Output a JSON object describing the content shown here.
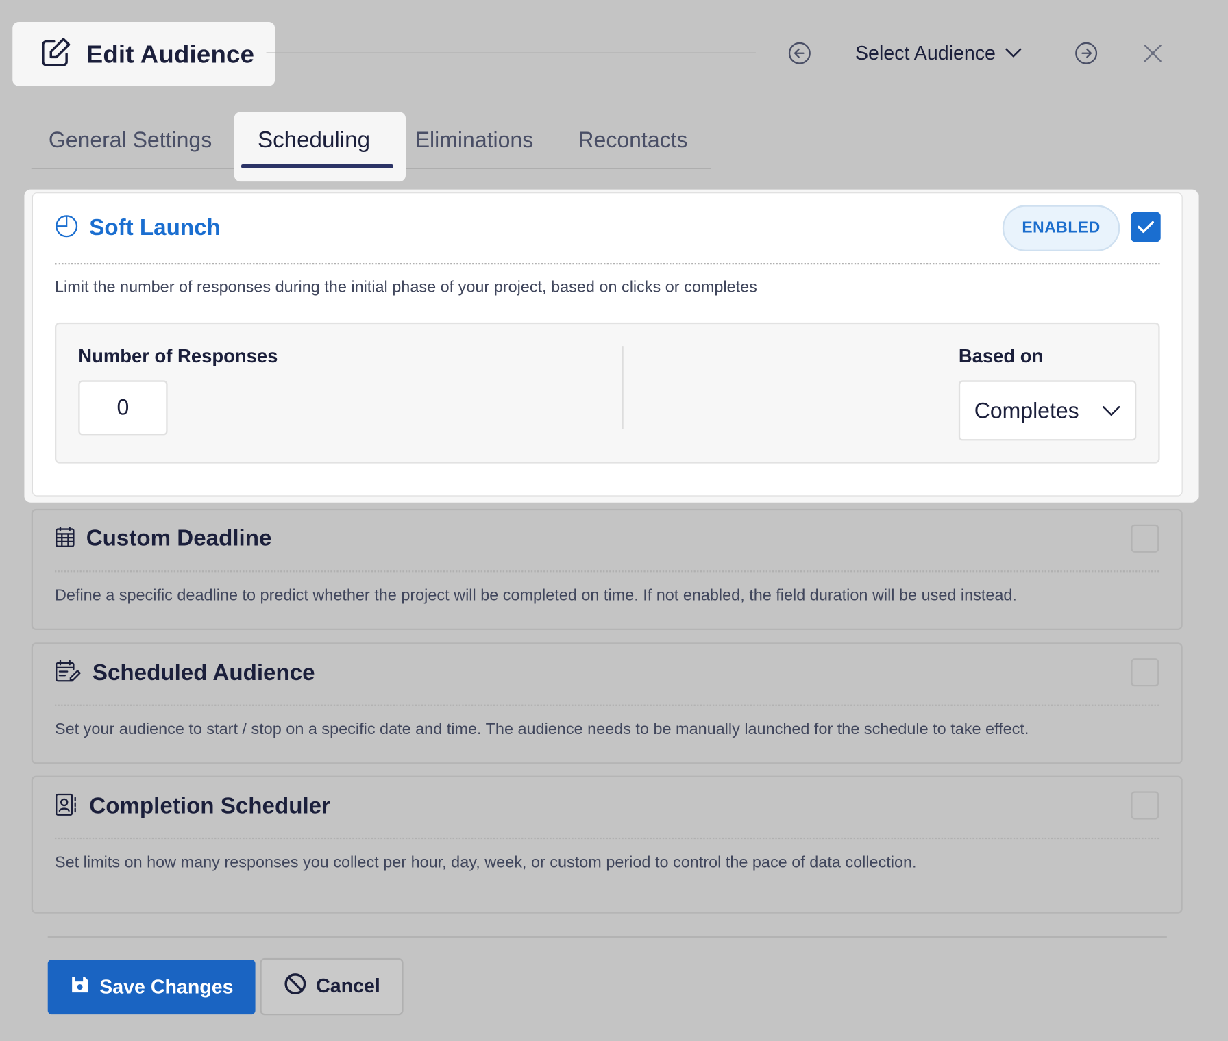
{
  "header": {
    "title": "Edit Audience",
    "select_audience_label": "Select Audience"
  },
  "tabs": [
    {
      "label": "General Settings",
      "active": false
    },
    {
      "label": "Scheduling",
      "active": true
    },
    {
      "label": "Eliminations",
      "active": false
    },
    {
      "label": "Recontacts",
      "active": false
    }
  ],
  "soft_launch": {
    "title": "Soft Launch",
    "status_badge": "ENABLED",
    "checked": true,
    "description": "Limit the number of responses during the initial phase of your project, based on clicks or completes",
    "responses_label": "Number of Responses",
    "responses_value": "0",
    "based_on_label": "Based on",
    "based_on_value": "Completes"
  },
  "sections": [
    {
      "title": "Custom Deadline",
      "icon": "calendar-icon",
      "checked": false,
      "description": "Define a specific deadline to predict whether the project will be completed on time. If not enabled, the field duration will be used instead."
    },
    {
      "title": "Scheduled Audience",
      "icon": "calendar-edit-icon",
      "checked": false,
      "description": "Set your audience to start / stop on a specific date and time. The audience needs to be manually launched for the schedule to take effect."
    },
    {
      "title": "Completion Scheduler",
      "icon": "contact-book-icon",
      "checked": false,
      "description": "Set limits on how many responses you collect per hour, day, week, or custom period to control the pace of data collection."
    }
  ],
  "footer": {
    "save_label": "Save Changes",
    "cancel_label": "Cancel"
  },
  "colors": {
    "accent": "#1a6ed0",
    "primary_button": "#1a64c2",
    "overlay_background": "#c4c4c4",
    "text_dark": "#1b1f3b"
  }
}
